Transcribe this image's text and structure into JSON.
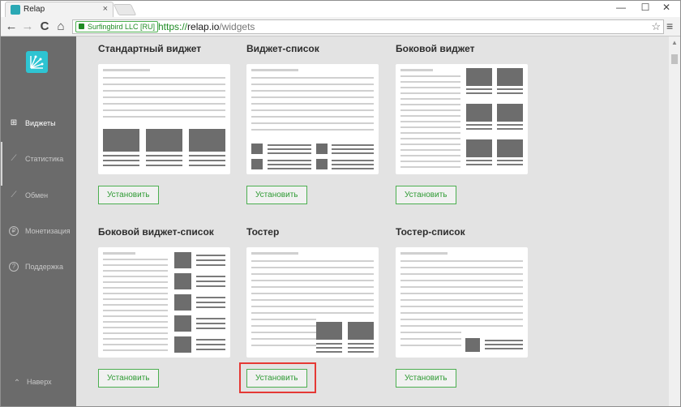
{
  "browser": {
    "tab_title": "Relap",
    "tab_close": "×",
    "window_min": "—",
    "window_max": "☐",
    "window_close": "✕",
    "ev_label": "Surfingbird LLC [RU]",
    "url_scheme": "https://",
    "url_host": "relap.io",
    "url_path": "/widgets",
    "back": "←",
    "forward": "→",
    "reload": "C",
    "home": "⌂",
    "star": "☆",
    "menu": "≡"
  },
  "sidebar": {
    "items": [
      {
        "label": "Виджеты",
        "icon": "grid-icon",
        "glyph": "⊞"
      },
      {
        "label": "Статистика",
        "icon": "chart-icon",
        "glyph": "⟋"
      },
      {
        "label": "Обмен",
        "icon": "exchange-icon",
        "glyph": "⟋"
      },
      {
        "label": "Монетизация",
        "icon": "ruble-icon",
        "glyph": "₽"
      },
      {
        "label": "Поддержка",
        "icon": "help-icon",
        "glyph": "?"
      }
    ],
    "back_label": "Наверх",
    "back_glyph": "⌃"
  },
  "widgets": [
    {
      "title": "Стандартный виджет",
      "button": "Установить"
    },
    {
      "title": "Виджет-список",
      "button": "Установить"
    },
    {
      "title": "Боковой виджет",
      "button": "Установить"
    },
    {
      "title": "Боковой виджет-список",
      "button": "Установить"
    },
    {
      "title": "Тостер",
      "button": "Установить"
    },
    {
      "title": "Тостер-список",
      "button": "Установить"
    }
  ],
  "colors": {
    "accent_green": "#4caf50",
    "highlight_red": "#e53935",
    "sidebar_bg": "#6b6b6b",
    "logo_teal": "#2ec4d2"
  }
}
